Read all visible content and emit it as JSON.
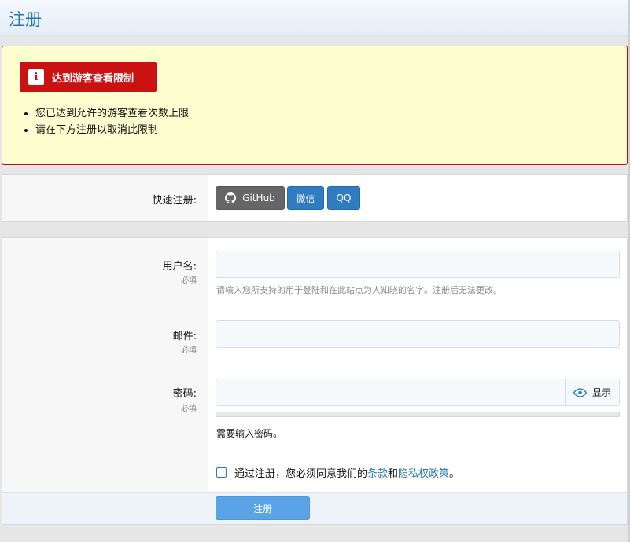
{
  "page": {
    "title": "注册"
  },
  "alert": {
    "title": "达到游客查看限制",
    "items": [
      "您已达到允许的游客查看次数上限",
      "请在下方注册以取消此限制"
    ]
  },
  "quick_register": {
    "label": "快速注册:",
    "buttons": {
      "github": "GitHub",
      "wechat": "微信",
      "qq": "QQ"
    }
  },
  "form": {
    "required_label": "必填",
    "username": {
      "label": "用户名:",
      "value": "",
      "hint": "请输入您所支持的用于登陆和在此站点为人知晓的名字。注册后无法更改。"
    },
    "email": {
      "label": "邮件:",
      "value": ""
    },
    "password": {
      "label": "密码:",
      "value": "",
      "show_label": "显示",
      "message": "需要输入密码。"
    },
    "agree": {
      "checked": false,
      "prefix": "通过注册，您必须同意我们的",
      "terms": "条款",
      "and": "和",
      "privacy": "隐私权政策",
      "suffix": "。"
    },
    "submit_label": "注册"
  },
  "colors": {
    "title": "#2577b1",
    "alert_bg": "#fefed1",
    "alert_border": "#c20c17",
    "primary": "#2f7cbf",
    "submit": "#5aa3e6"
  }
}
